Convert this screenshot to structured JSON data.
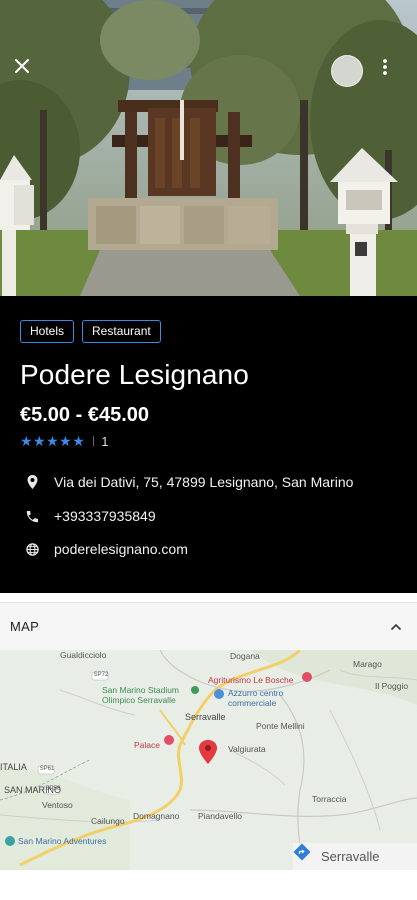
{
  "hero": {
    "icons": {
      "close": "close-icon",
      "avatar": "avatar",
      "more": "more-vert-icon"
    }
  },
  "info": {
    "tags": [
      "Hotels",
      "Restaurant"
    ],
    "title": "Podere Lesignano",
    "price": "€5.00 - €45.00",
    "rating": {
      "stars": "★★★★★",
      "value": 5,
      "count": "1"
    },
    "address": "Via dei Dativi, 75, 47899 Lesignano, San Marino",
    "phone": "+393337935849",
    "website": "poderelesignano.com",
    "icons": {
      "address": "location-pin-icon",
      "phone": "phone-icon",
      "website": "globe-icon"
    }
  },
  "map": {
    "section_label": "MAP",
    "directions_label": "Serravalle",
    "place_labels": {
      "gualdicciolo": "Gualdicciolo",
      "dogana": "Dogana",
      "marago": "Marago",
      "il_poggio": "Il Poggio",
      "stadium": "San Marino Stadium\nOlimpico Serravalle",
      "agriturismo": "Agriturismo Le Bosche",
      "azzurro": "Azzurro centro\ncommerciale",
      "serravalle": "Serravalle",
      "ponte_mellini": "Ponte Mellini",
      "palace": "Palace",
      "valgiurata": "Valgiurata",
      "italia": "ITALIA",
      "san_marino": "SAN MARINO",
      "ventoso": "Ventoso",
      "cailungo": "Cailungo",
      "domagnano": "Domagnano",
      "piandavello": "Piandavello",
      "torraccia": "Torraccia",
      "adventures": "San Marino Adventures",
      "rd_sp72": "SP72",
      "rd_sp61": "SP61",
      "rd_sp58": "SP58"
    },
    "colors": {
      "marker": "#e4393f",
      "poi_blue": "#4a8fd8",
      "poi_red": "#e34d67"
    }
  },
  "colors": {
    "accent": "#3d8ae0",
    "info_bg": "#000000"
  }
}
